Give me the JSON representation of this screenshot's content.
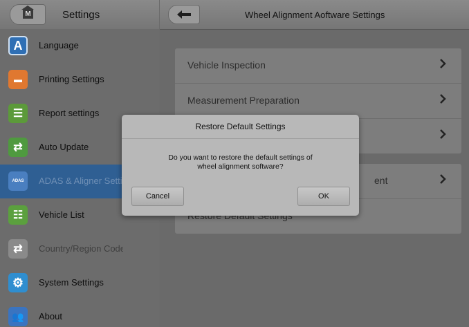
{
  "sidebar": {
    "title": "Settings",
    "home_icon_letter": "M",
    "items": [
      {
        "label": "Language",
        "icon": "language-icon",
        "glyph": "A",
        "color": "#2f6fb4"
      },
      {
        "label": "Printing Settings",
        "icon": "printer-icon",
        "glyph": "▬",
        "color": "#e07830"
      },
      {
        "label": "Report settings",
        "icon": "report-icon",
        "glyph": "☰",
        "color": "#5c9a3a"
      },
      {
        "label": "Auto Update",
        "icon": "refresh-icon",
        "glyph": "⇄",
        "color": "#4f9a3f"
      },
      {
        "label": "ADAS & Aligner Settings",
        "icon": "adas-icon",
        "glyph": "ADAS",
        "color": "#4a7fc0"
      },
      {
        "label": "Vehicle List",
        "icon": "vehicle-list-icon",
        "glyph": "☷",
        "color": "#5ba03e"
      },
      {
        "label": "Country/Region Code",
        "icon": "region-code-icon",
        "glyph": "⇄",
        "color": "#8a8a8a"
      },
      {
        "label": "System Settings",
        "icon": "gear-icon",
        "glyph": "⚙",
        "color": "#2f8ed0"
      },
      {
        "label": "About",
        "icon": "about-icon",
        "glyph": "👥",
        "color": "#3a74c0"
      }
    ]
  },
  "main": {
    "title": "Wheel Alignment Aoftware Settings",
    "card1": [
      "Vehicle Inspection",
      "Measurement Preparation",
      ""
    ],
    "card2": [
      "ent",
      "Restore Default Settings"
    ]
  },
  "dialog": {
    "title": "Restore Default Settings",
    "message_line1": "Do you want to restore the default settings of",
    "message_line2": "wheel alignment software?",
    "cancel": "Cancel",
    "ok": "OK"
  }
}
